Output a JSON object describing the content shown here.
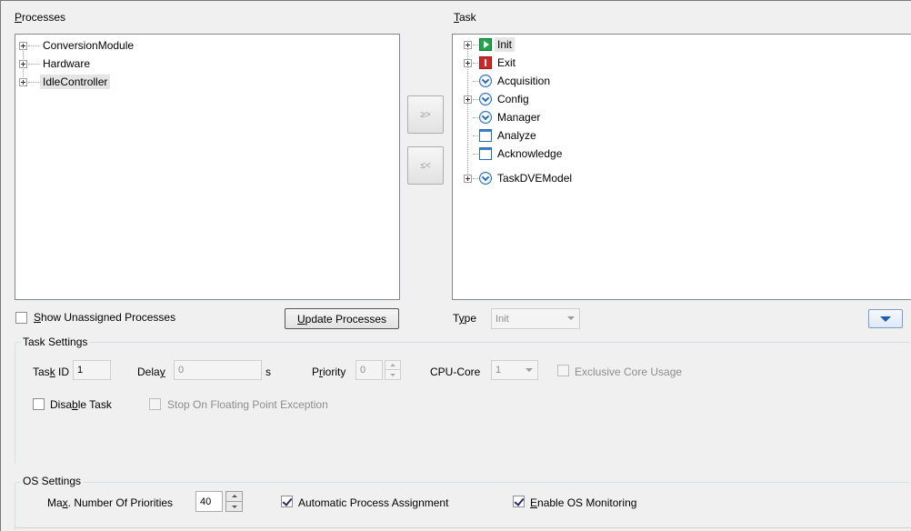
{
  "processes": {
    "label_u": "P",
    "label_rest": "rocesses",
    "items": [
      {
        "label": "ConversionModule"
      },
      {
        "label": "Hardware"
      },
      {
        "label": "IdleController"
      }
    ]
  },
  "tasks": {
    "label_u": "T",
    "label_rest": "ask",
    "items": [
      {
        "label": "Init",
        "icon": "play-icon"
      },
      {
        "label": "Exit",
        "icon": "stop-icon"
      },
      {
        "label": "Acquisition",
        "icon": "clock-icon"
      },
      {
        "label": "Config",
        "icon": "clock-icon"
      },
      {
        "label": "Manager",
        "icon": "clock-icon"
      },
      {
        "label": "Analyze",
        "icon": "window-icon"
      },
      {
        "label": "Acknowledge",
        "icon": "window-icon"
      },
      {
        "label": "TaskDVEModel",
        "icon": "clock-icon"
      }
    ]
  },
  "move_buttons": {
    "assign": "≥>",
    "unassign": "≤<"
  },
  "show_unassigned": {
    "u": "S",
    "rest": "how Unassigned Processes",
    "checked": false
  },
  "update_button": {
    "u": "U",
    "rest": "pdate Processes"
  },
  "type": {
    "label_pre": "T",
    "label_u": "y",
    "label_post": "pe",
    "value": "Init"
  },
  "task_settings": {
    "title": "Task Settings",
    "task_id_pre": "Tas",
    "task_id_u": "k",
    "task_id_post": " ID",
    "task_id_value": "1",
    "delay_pre": "Dela",
    "delay_u": "y",
    "delay_value": "0",
    "delay_unit": "s",
    "priority_pre": "P",
    "priority_u": "r",
    "priority_post": "iority",
    "priority_value": "0",
    "cpu_core_label": "CPU-Core",
    "cpu_core_value": "1",
    "exclusive_label": "Exclusive Core Usage",
    "disable_pre": "Disa",
    "disable_u": "b",
    "disable_post": "le Task",
    "fp_exception_label": "Stop On Floating Point Exception"
  },
  "os_settings": {
    "title": "OS Settings",
    "max_pre": "Ma",
    "max_u": "x",
    "max_post": ". Number Of Priorities",
    "max_value": "40",
    "auto_pre": "Automatic Process Assi",
    "auto_u": "g",
    "auto_post": "nment",
    "auto_checked": true,
    "monitor_u": "E",
    "monitor_post": "nable OS Monitoring",
    "monitor_checked": true
  }
}
